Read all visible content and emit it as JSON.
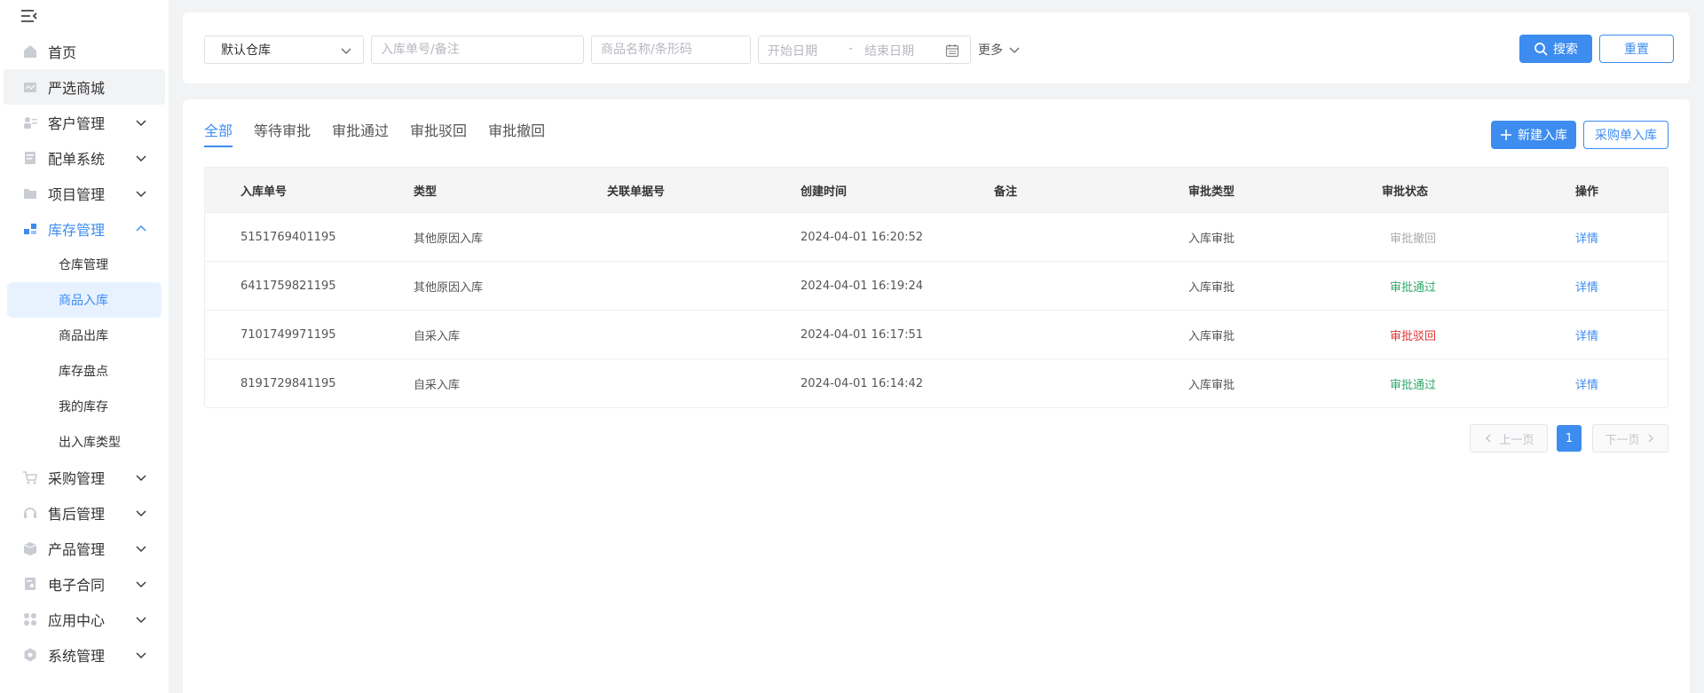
{
  "sidebar": {
    "items": [
      {
        "label": "首页",
        "icon": "home-icon"
      },
      {
        "label": "严选商城",
        "icon": "mall-icon"
      },
      {
        "label": "客户管理",
        "icon": "customer-icon"
      },
      {
        "label": "配单系统",
        "icon": "order-icon"
      },
      {
        "label": "项目管理",
        "icon": "folder-icon"
      },
      {
        "label": "库存管理",
        "icon": "inventory-icon"
      },
      {
        "label": "采购管理",
        "icon": "cart-icon"
      },
      {
        "label": "售后管理",
        "icon": "headset-icon"
      },
      {
        "label": "产品管理",
        "icon": "box-icon"
      },
      {
        "label": "电子合同",
        "icon": "contract-icon"
      },
      {
        "label": "应用中心",
        "icon": "apps-icon"
      },
      {
        "label": "系统管理",
        "icon": "settings-icon"
      }
    ],
    "inventory_sub": [
      "仓库管理",
      "商品入库",
      "商品出库",
      "库存盘点",
      "我的库存",
      "出入库类型"
    ]
  },
  "filters": {
    "warehouse": "默认仓库",
    "order_placeholder": "入库单号/备注",
    "goods_placeholder": "商品名称/条形码",
    "start_date": "开始日期",
    "date_sep": "-",
    "end_date": "结束日期",
    "more": "更多",
    "search": "搜索",
    "reset": "重置"
  },
  "tabs": [
    "全部",
    "等待审批",
    "审批通过",
    "审批驳回",
    "审批撤回"
  ],
  "actions": {
    "new_inbound": "新建入库",
    "po_inbound": "采购单入库"
  },
  "table": {
    "columns": [
      "入库单号",
      "类型",
      "关联单据号",
      "创建时间",
      "备注",
      "审批类型",
      "审批状态",
      "操作"
    ],
    "rows": [
      {
        "id": "5151769401195",
        "type": "其他原因入库",
        "ref": "",
        "time": "2024-04-01 16:20:52",
        "note": "",
        "approval_type": "入库审批",
        "status": "审批撤回",
        "action": "详情"
      },
      {
        "id": "6411759821195",
        "type": "其他原因入库",
        "ref": "",
        "time": "2024-04-01 16:19:24",
        "note": "",
        "approval_type": "入库审批",
        "status": "审批通过",
        "action": "详情"
      },
      {
        "id": "7101749971195",
        "type": "自采入库",
        "ref": "",
        "time": "2024-04-01 16:17:51",
        "note": "",
        "approval_type": "入库审批",
        "status": "审批驳回",
        "action": "详情"
      },
      {
        "id": "8191729841195",
        "type": "自采入库",
        "ref": "",
        "time": "2024-04-01 16:14:42",
        "note": "",
        "approval_type": "入库审批",
        "status": "审批通过",
        "action": "详情"
      }
    ]
  },
  "pagination": {
    "prev": "上一页",
    "current": "1",
    "next": "下一页"
  },
  "colors": {
    "primary": "#3d8cf0",
    "pass": "#2faa6d",
    "reject": "#e03434",
    "revoked": "#aaaaaa"
  }
}
